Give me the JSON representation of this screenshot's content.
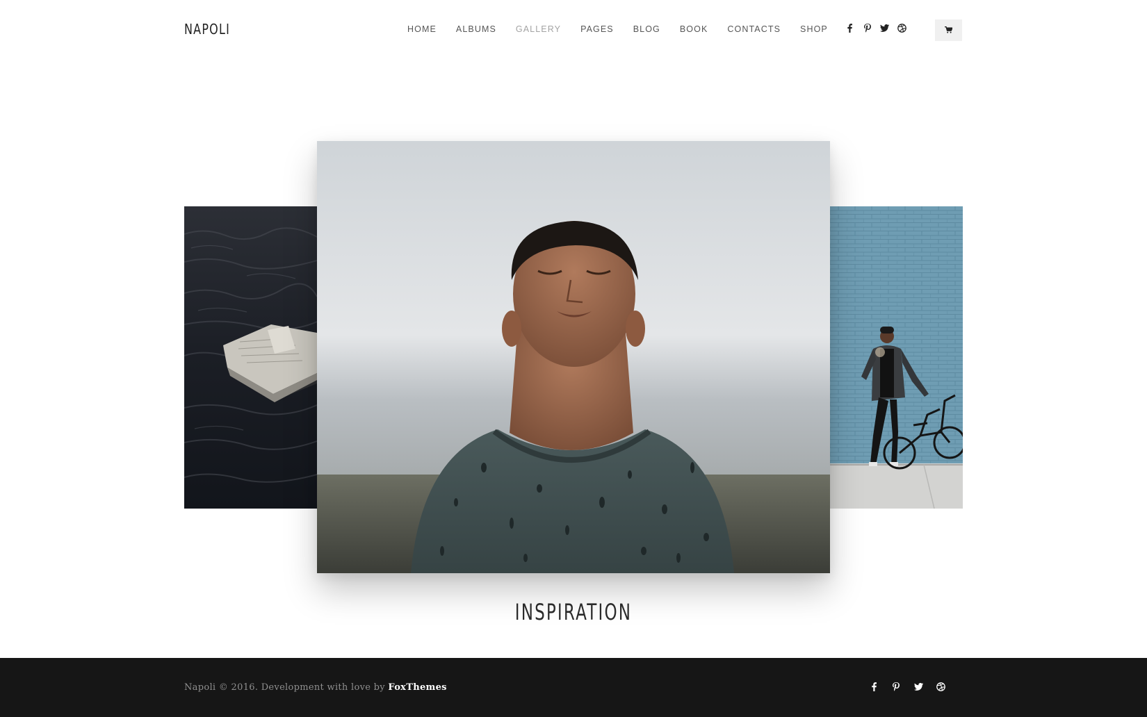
{
  "header": {
    "logo": "NAPOLI",
    "nav": [
      {
        "label": "HOME",
        "active": false
      },
      {
        "label": "ALBUMS",
        "active": false
      },
      {
        "label": "GALLERY",
        "active": true
      },
      {
        "label": "PAGES",
        "active": false
      },
      {
        "label": "BLOG",
        "active": false
      },
      {
        "label": "BOOK",
        "active": false
      },
      {
        "label": "CONTACTS",
        "active": false
      },
      {
        "label": "SHOP",
        "active": false
      }
    ],
    "social_icons": [
      "facebook-icon",
      "pinterest-icon",
      "twitter-icon",
      "dribbble-icon"
    ],
    "cart_icon": "cart-icon"
  },
  "gallery": {
    "current_title": "INSPIRATION",
    "slides": [
      {
        "name": "newspaper-on-water-photo"
      },
      {
        "name": "man-in-rain-photo"
      },
      {
        "name": "man-with-bike-photo"
      }
    ]
  },
  "footer": {
    "copyright_prefix": "Napoli © 2016. Development with love by ",
    "brand": "FoxThemes",
    "social_icons": [
      "facebook-icon",
      "pinterest-icon",
      "twitter-icon",
      "dribbble-icon"
    ]
  },
  "colors": {
    "footer_bg": "#161616",
    "text_dark": "#222222",
    "nav_text": "#555555",
    "nav_active": "#a3a3a3",
    "cart_bg": "#f0f0f0"
  }
}
